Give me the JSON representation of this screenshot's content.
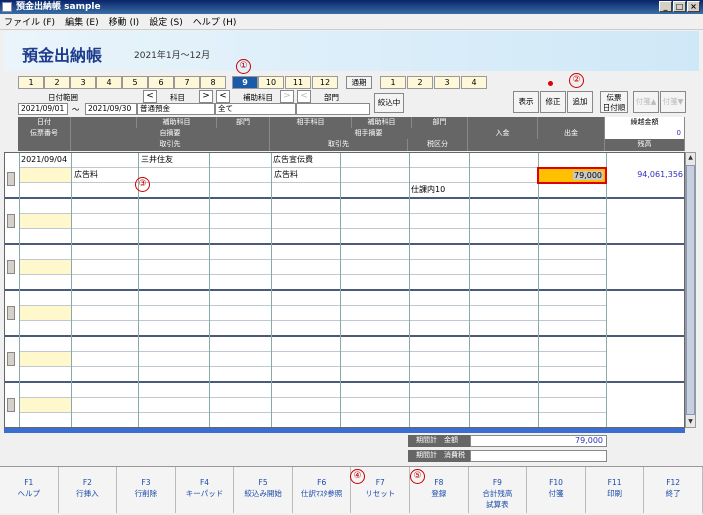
{
  "window": {
    "title": "預金出納帳 sample",
    "buttons": [
      "_",
      "□",
      "×"
    ]
  },
  "menu": [
    "ファイル (F)",
    "編集 (E)",
    "移動 (I)",
    "設定 (S)",
    "ヘルプ (H)"
  ],
  "header": {
    "title": "預金出納帳",
    "period": "2021年1月～12月"
  },
  "months": [
    "1",
    "2",
    "3",
    "4",
    "5",
    "6",
    "7",
    "8",
    "9",
    "10",
    "11",
    "12"
  ],
  "selected_month": "9",
  "tsuuki_label": "通期",
  "quarters": [
    "1",
    "2",
    "3",
    "4"
  ],
  "annotations": {
    "a1": "①",
    "a2": "②",
    "a3": "③",
    "a4": "④",
    "a5": "⑤"
  },
  "filter": {
    "date_range_label": "日付範囲",
    "date_from": "2021/09/01",
    "tilde": "～",
    "date_to": "2021/09/30",
    "account_label": "科目",
    "account_value": "普通預金",
    "sub_account_label": "補助科目",
    "sub_account_value": "全て",
    "dept_label": "部門",
    "narrow_button": "絞込中",
    "prev": "<",
    "next": ">"
  },
  "actions": {
    "display": "表示",
    "modify": "修正",
    "add": "追加",
    "slip_order": "伝票\n日付順",
    "tag_up": "付箋▲",
    "tag_down": "付箋▼"
  },
  "grid_header": {
    "r1": [
      "日付",
      "補助科目",
      "部門",
      "相手科目",
      "補助科目",
      "部門",
      "",
      "",
      "繰越金額"
    ],
    "r2": [
      "伝票番号",
      "自摘要",
      "相手摘要",
      "入金",
      "出金"
    ],
    "r3": [
      "取引先",
      "取引先",
      "税区分",
      "",
      "残高"
    ],
    "carry_value": "0"
  },
  "rows": [
    {
      "date": "2021/09/04",
      "partner": "三井住友",
      "counter_account": "広告宣伝費",
      "memo": "広告料",
      "counter_memo": "広告料",
      "tax": "仕課内10",
      "withdraw": "79,000",
      "balance": "94,061,356"
    }
  ],
  "totals": {
    "amount_label": "期間計　金額",
    "amount_value": "79,000",
    "tax_label": "期間計　消費税",
    "tax_value": ""
  },
  "fkeys": [
    {
      "k": "F1",
      "l": "ヘルプ"
    },
    {
      "k": "F2",
      "l": "行挿入"
    },
    {
      "k": "F3",
      "l": "行削除"
    },
    {
      "k": "F4",
      "l": "キーパッド"
    },
    {
      "k": "F5",
      "l": "絞込み開始"
    },
    {
      "k": "F6",
      "l": "仕訳ﾏｽﾀ参照"
    },
    {
      "k": "F7",
      "l": "リセット"
    },
    {
      "k": "F8",
      "l": "登録"
    },
    {
      "k": "F9",
      "l": "合計残高\n試算表"
    },
    {
      "k": "F10",
      "l": "付箋"
    },
    {
      "k": "F11",
      "l": "印刷"
    },
    {
      "k": "F12",
      "l": "終了"
    }
  ],
  "colors": {
    "accent": "#1a5aa8",
    "highlight": "#ffc000",
    "annotation": "#cc0000"
  }
}
